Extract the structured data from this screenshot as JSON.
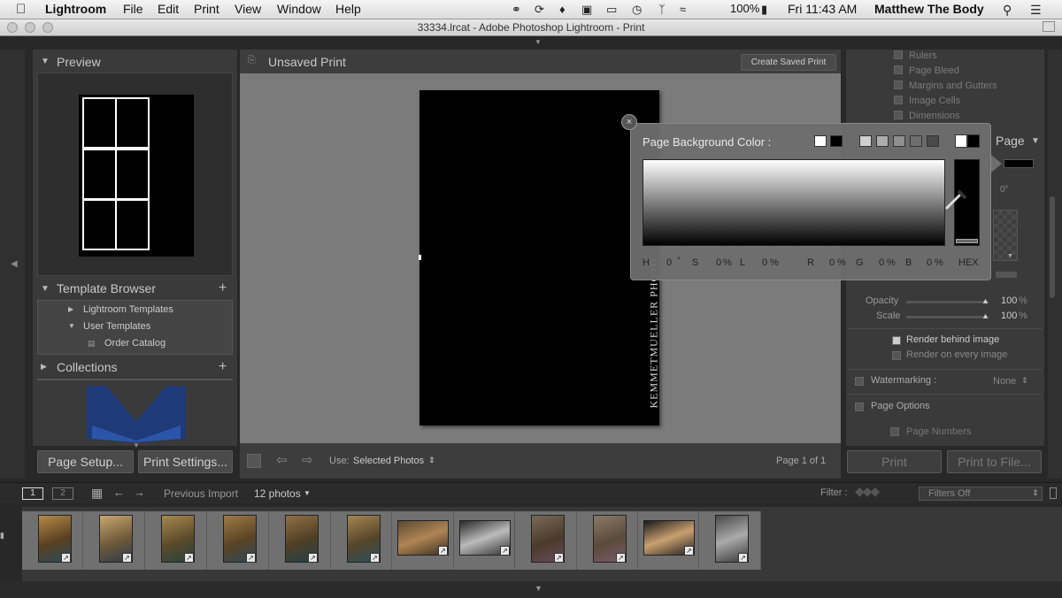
{
  "menubar": {
    "apple_icon": "apple-icon",
    "app_name": "Lightroom",
    "menus": [
      "File",
      "Edit",
      "Print",
      "View",
      "Window",
      "Help"
    ],
    "battery": "100%",
    "clock": "Fri 11:43 AM",
    "user": "Matthew The Body"
  },
  "window": {
    "title": "33334.lrcat - Adobe Photoshop Lightroom - Print"
  },
  "left_panel": {
    "preview_header": "Preview",
    "template_browser_header": "Template Browser",
    "template_items": [
      "Lightroom Templates",
      "User Templates",
      "Order Catalog"
    ],
    "collections_header": "Collections",
    "page_setup_button": "Page Setup...",
    "print_settings_button": "Print Settings..."
  },
  "center": {
    "title": "Unsaved Print",
    "create_saved_print_button": "Create Saved Print",
    "page_text": "KEMMETMUELLER PHOTO",
    "use_label": "Use:",
    "use_value": "Selected Photos",
    "page_count": "Page 1 of 1"
  },
  "color_dialog": {
    "title": "Page Background Color :",
    "fields": {
      "H": {
        "label": "H",
        "value": "0",
        "unit": "°"
      },
      "S": {
        "label": "S",
        "value": "0",
        "unit": "%"
      },
      "L": {
        "label": "L",
        "value": "0",
        "unit": "%"
      },
      "R": {
        "label": "R",
        "value": "0",
        "unit": "%"
      },
      "G": {
        "label": "G",
        "value": "0",
        "unit": "%"
      },
      "B": {
        "label": "B",
        "value": "0",
        "unit": "%"
      }
    },
    "hex_label": "HEX"
  },
  "right_panel": {
    "guides": [
      "Rulers",
      "Page Bleed",
      "Margins and Gutters",
      "Image Cells",
      "Dimensions"
    ],
    "page_header": "Page",
    "angle": "0°",
    "opacity_label": "Opacity",
    "opacity_value": "100",
    "opacity_unit": "%",
    "scale_label": "Scale",
    "scale_value": "100",
    "scale_unit": "%",
    "render_behind": "Render behind image",
    "render_every": "Render on every image",
    "watermarking_label": "Watermarking :",
    "watermarking_value": "None",
    "page_options": "Page Options",
    "page_numbers": "Page Numbers",
    "print_button": "Print",
    "print_to_file_button": "Print to File..."
  },
  "filmstrip_bar": {
    "view1": "1",
    "view2": "2",
    "source": "Previous Import",
    "count": "12 photos",
    "filter_label": "Filter :",
    "filter_value": "Filters Off"
  },
  "colors": {
    "panel_bg": "#3a3a3a",
    "canvas_bg": "#7a7a7a",
    "page_bg": "#000000",
    "dialog_bg": "#6e6e6e",
    "accent_blue": "#2b55a8"
  }
}
